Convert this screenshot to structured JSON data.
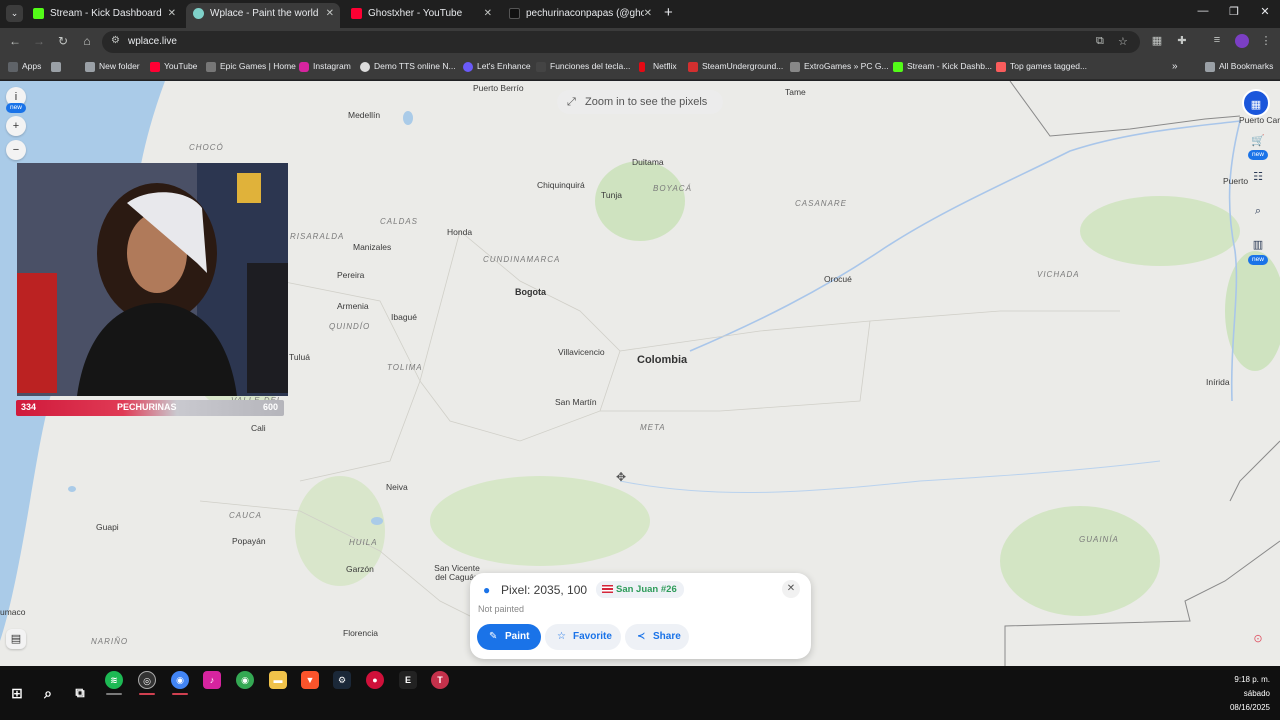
{
  "browser": {
    "tabs": [
      {
        "title": "Stream - Kick Dashboard",
        "active": false
      },
      {
        "title": "Wplace - Paint the world",
        "active": true
      },
      {
        "title": "Ghostxher - YouTube",
        "active": false
      },
      {
        "title": "pechurinaconpapas (@ghostxhe",
        "active": false
      }
    ],
    "url": "wplace.live",
    "bookmarks": [
      "Apps",
      "New folder",
      "YouTube",
      "Epic Games | Home",
      "Instagram",
      "Demo TTS online N...",
      "Let's Enhance",
      "Funciones del tecla...",
      "Netflix",
      "SteamUnderground...",
      "ExtroGames » PC G...",
      "Stream - Kick Dashb...",
      "Top games tagged..."
    ],
    "all_bookmarks": "All Bookmarks"
  },
  "map": {
    "zoom_hint": "Zoom in to see the pixels",
    "country": "Colombia",
    "capital": "Bogota",
    "places": [
      "Puerto Berrío",
      "Tame",
      "Medellín",
      "Duitama",
      "Chiquinquirá",
      "Tunja",
      "Manizales",
      "Honda",
      "Pereira",
      "Armenia",
      "Ibagué",
      "Villavicencio",
      "Orocué",
      "Inírida",
      "San Martín",
      "Cali",
      "Neiva",
      "Guapi",
      "Popayán",
      "Garzón",
      "San Vicente del Caguán",
      "Florencia",
      "Tuluá",
      "Puerto Car",
      "Puerto",
      "umaco"
    ],
    "regions": [
      "CHOCÓ",
      "BOYACÁ",
      "CASANARE",
      "CALDAS",
      "CUNDINAMARCA",
      "RISARALDA",
      "VICHADA",
      "QUINDÍO",
      "TOLIMA",
      "META",
      "VALLE DEL CAUCA",
      "CAUCA",
      "HUILA",
      "GUAINÍA",
      "NARIÑO"
    ],
    "left_badge": "new",
    "right_badges": [
      "new",
      "new"
    ]
  },
  "stream_overlay": {
    "left_count": "334",
    "name": "PECHURINAS",
    "right_count": "600"
  },
  "pixel_panel": {
    "coords": "Pixel: 2035, 100",
    "region_tag": "San Juan #26",
    "status": "Not painted",
    "buttons": {
      "paint": "Paint",
      "favorite": "Favorite",
      "share": "Share"
    }
  },
  "clock": {
    "time": "9:18 p. m.",
    "day": "sábado",
    "date": "08/16/2025"
  },
  "colors": {
    "accent": "#1a73e8",
    "tag_green": "#2e9c5a",
    "map_bg": "#ebebe8"
  }
}
